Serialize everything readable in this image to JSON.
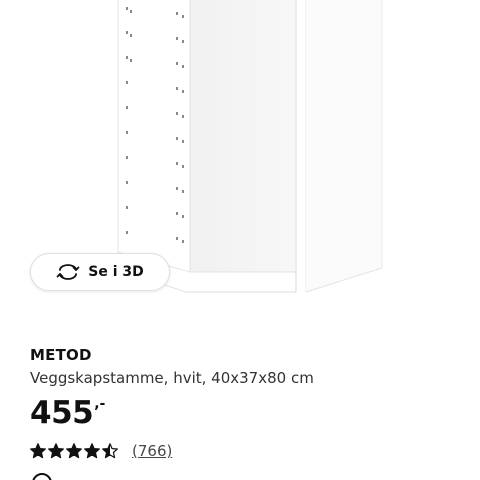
{
  "view3d": {
    "label": "Se i 3D",
    "icon": "rotate-3d-icon"
  },
  "product": {
    "brand": "METOD",
    "description": "Veggskapstamme, hvit, 40x37x80 cm",
    "price_integer": "455",
    "price_suffix": ",-",
    "rating_value": 4.5,
    "rating_max": 5,
    "review_count": "(766)"
  },
  "colors": {
    "text": "#111111",
    "cabinet": "#ffffff",
    "cabinet_shadow": "#eeeeee"
  }
}
